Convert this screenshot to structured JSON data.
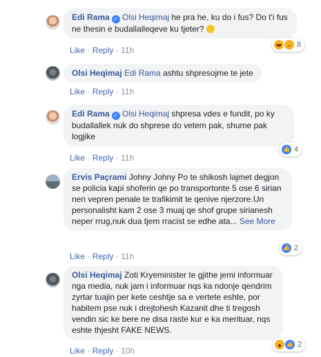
{
  "ui": {
    "like": "Like",
    "reply": "Reply",
    "sep": "·",
    "verified_glyph": "✓"
  },
  "comments": [
    {
      "author": "Edi Rama",
      "mention": "Olsi Heqimaj",
      "text": " he pra he, ku do i fus? Do t'i fus ne thesin e budallalleqeve ku tjeter?",
      "time": "11h",
      "reaction_icons": [
        "haha-icon",
        "sad-icon"
      ],
      "reaction_count": "8"
    },
    {
      "author": "Olsi Heqimaj",
      "mention": "Edi Rama",
      "text": " ashtu shpresojme te jete",
      "time": "11h"
    },
    {
      "author": "Edi Rama",
      "mention": "Olsi Heqimaj",
      "text": " shpresa vdes e fundit, po ky budallallek nuk do shprese do vetem pak, shume pak logjike",
      "time": "11h",
      "reaction_icons": [
        "like-icon"
      ],
      "reaction_count": "4"
    },
    {
      "author": "Ervis Paçrami",
      "text": " Johny Johny Po te shikosh lajmet degjon se policia kapi shoferin qe po transportonte 5 ose 6 sirian nen vepren penale te trafikimit te qenive njerzore.Un personalisht kam 2 ose 3 muaj qe shof grupe sirianesh neper rrug,nuk dua tjem rracist se edhe ata...",
      "see_more": "See More",
      "time": "11h",
      "reaction_icons": [
        "like-icon"
      ],
      "reaction_count": "2"
    },
    {
      "author": "Olsi Heqimaj",
      "text": " Zoti Kryeminister te gjithe jemi informuar nga media, nuk jam i informuar nqs ka ndonje qendrim zyrtar tuajin per kete ceshtje sa e vertete eshte, por habitem pse nuk i drejtohesh Kazanit dhe ti tregosh vendin sic ke bere ne disa raste kur e ka merituar, nqs eshte thjesht FAKE NEWS.",
      "time": "10h",
      "reaction_icons": [
        "wow-icon",
        "like-icon"
      ],
      "reaction_count": "2"
    }
  ]
}
